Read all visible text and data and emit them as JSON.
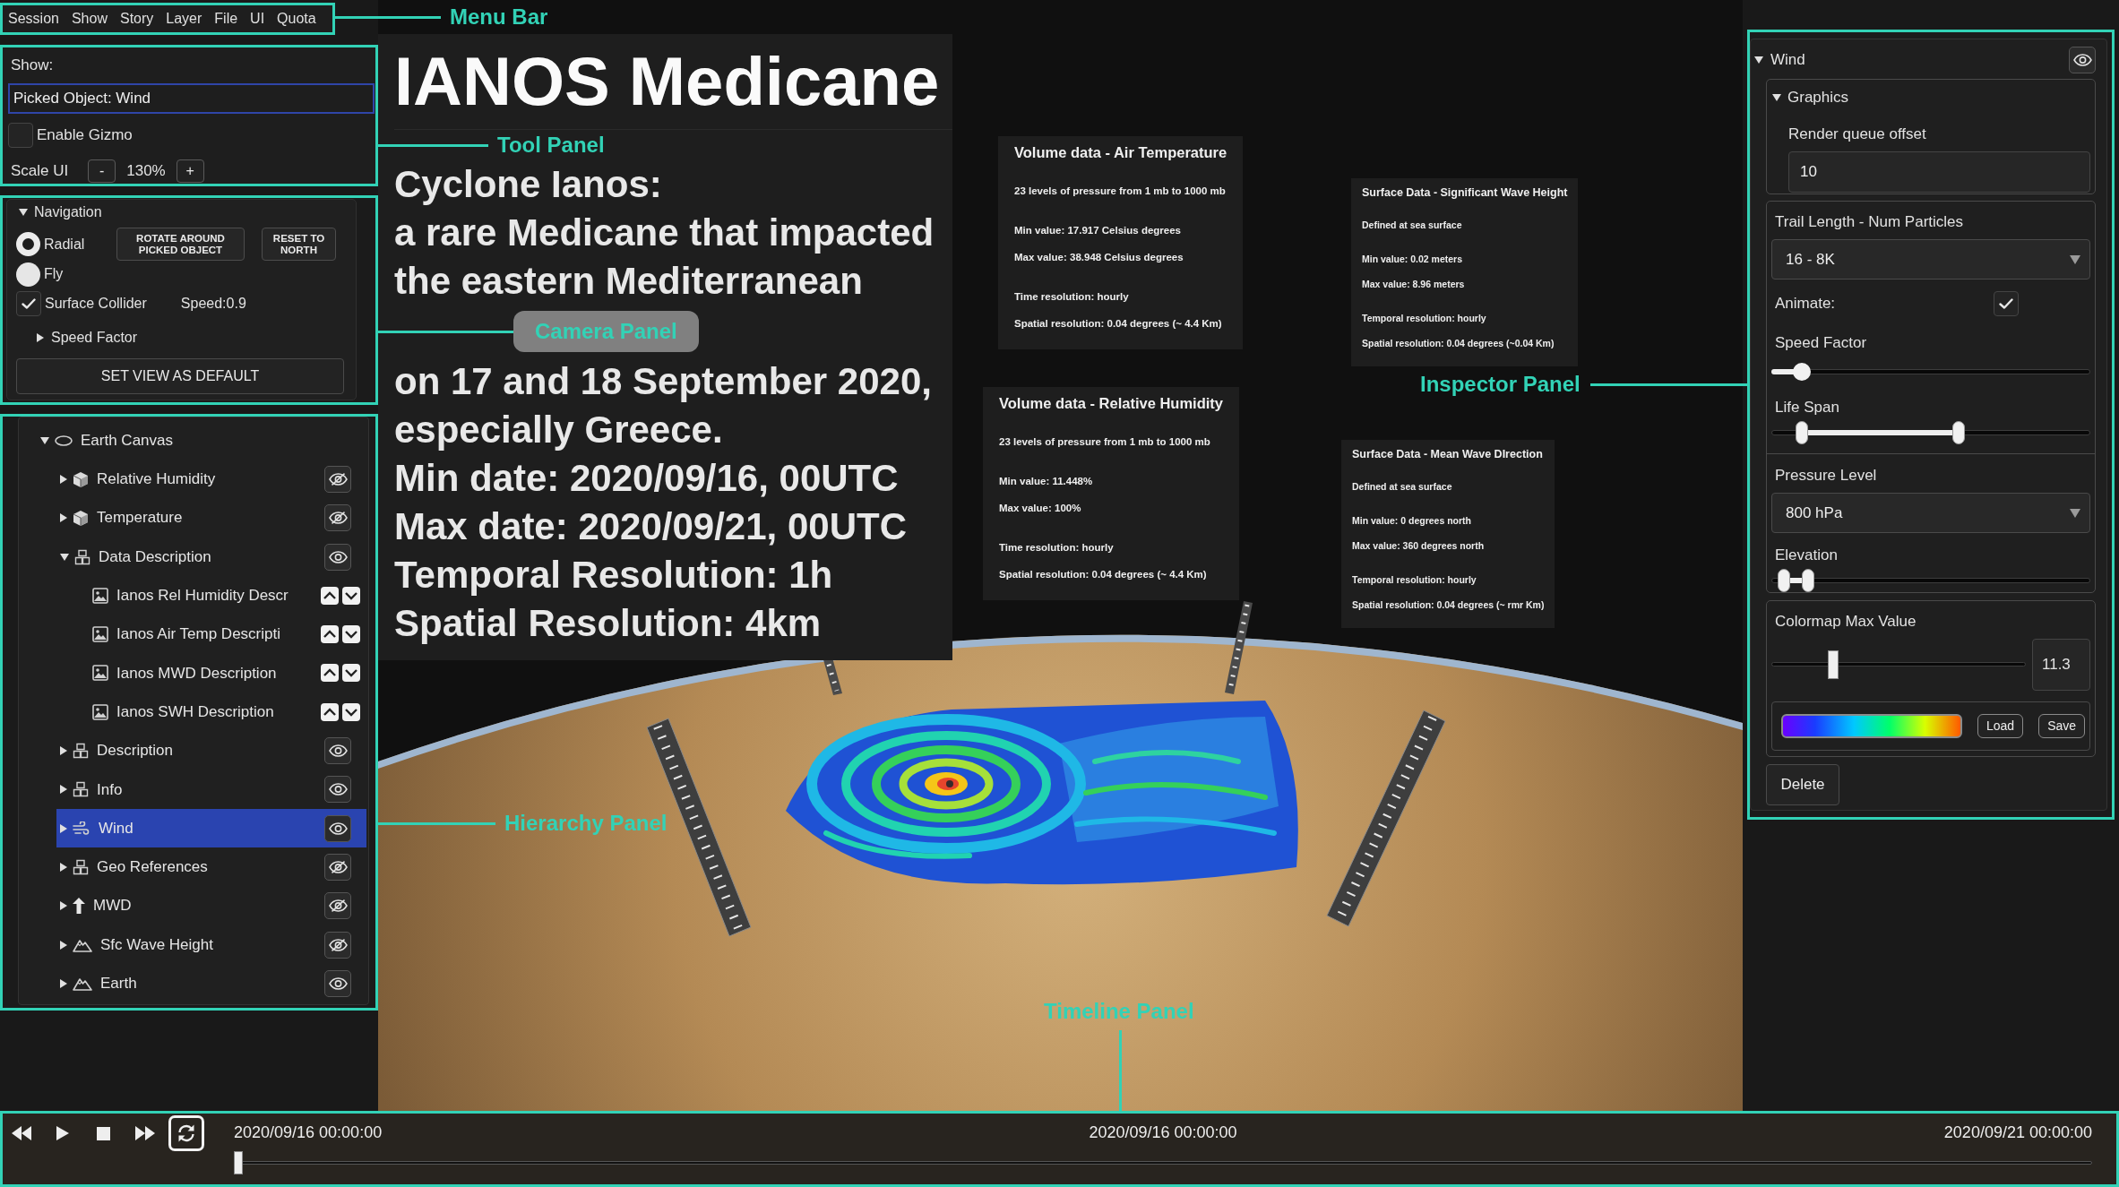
{
  "menu_bar": {
    "callout": "Menu Bar",
    "items": [
      "Session",
      "Show",
      "Story",
      "Layer",
      "File",
      "UI",
      "Quota"
    ]
  },
  "tool_panel": {
    "callout": "Tool Panel",
    "show_label": "Show:",
    "picked_object": {
      "value": "Picked Object: Wind"
    },
    "enable_gizmo": {
      "label": "Enable Gizmo",
      "checked": false
    },
    "scale_ui": {
      "label": "Scale UI",
      "decrease": "-",
      "value": "130%",
      "increase": "+"
    }
  },
  "navigation": {
    "callout": "Camera Panel",
    "title": "Navigation",
    "expanded": true,
    "modes": [
      {
        "label": "Radial",
        "selected": true
      },
      {
        "label": "Fly",
        "selected": false
      }
    ],
    "buttons": [
      "ROTATE AROUND PICKED OBJECT",
      "RESET TO NORTH"
    ],
    "surface_collider": {
      "label": "Surface Collider",
      "checked": true
    },
    "speed": "Speed:0.9",
    "speed_factor": {
      "label": "Speed Factor",
      "expanded": false
    },
    "default_button": "SET VIEW AS DEFAULT"
  },
  "hierarchy": {
    "callout": "Hierarchy Panel",
    "items": [
      {
        "label": "Earth Canvas",
        "kind": "canvas",
        "expanded": true,
        "selected": false,
        "children": [
          {
            "label": "Relative Humidity",
            "kind": "volume",
            "expanded": false,
            "visible": false,
            "selected": false
          },
          {
            "label": "Temperature",
            "kind": "volume",
            "expanded": false,
            "visible": false,
            "selected": false
          },
          {
            "label": "Data Description",
            "kind": "group",
            "expanded": true,
            "visible": true,
            "selected": false,
            "children": [
              {
                "label": "Ianos Rel Humidity Descr",
                "kind": "image",
                "selected": false
              },
              {
                "label": "Ianos Air Temp Descripti",
                "kind": "image",
                "selected": false
              },
              {
                "label": "Ianos MWD Description",
                "kind": "image",
                "selected": false
              },
              {
                "label": "Ianos SWH Description",
                "kind": "image",
                "selected": false
              }
            ]
          },
          {
            "label": "Description",
            "kind": "group",
            "expanded": false,
            "visible": true,
            "selected": false
          },
          {
            "label": "Info",
            "kind": "group",
            "expanded": false,
            "visible": true,
            "selected": false
          },
          {
            "label": "Wind",
            "kind": "wind",
            "expanded": false,
            "visible": true,
            "selected": true
          },
          {
            "label": "Geo References",
            "kind": "group",
            "expanded": false,
            "visible": false,
            "selected": false
          },
          {
            "label": "MWD",
            "kind": "vector",
            "expanded": false,
            "visible": false,
            "selected": false
          },
          {
            "label": "Sfc Wave Height",
            "kind": "terrain",
            "expanded": false,
            "visible": false,
            "selected": false
          },
          {
            "label": "Earth",
            "kind": "terrain",
            "expanded": false,
            "visible": true,
            "selected": false
          }
        ]
      }
    ]
  },
  "scene": {
    "title": "IANOS Medicane",
    "lines": [
      "Cyclone Ianos:",
      "a rare Medicane that impacted",
      "the eastern Mediterranean",
      "on 17 and 18 September 2020,",
      "especially Greece.",
      "Min date: 2020/09/16, 00UTC",
      "Max date: 2020/09/21, 00UTC",
      "Temporal Resolution: 1h",
      "Spatial Resolution: 4km"
    ],
    "cards": [
      {
        "kind": "volume",
        "title": "Volume data - Air Temperature",
        "groups": [
          [
            "23 levels of pressure from 1 mb to 1000 mb"
          ],
          [
            "Min value: 17.917 Celsius degrees",
            "Max value: 38.948 Celsius degrees"
          ],
          [
            "Time resolution: hourly",
            "Spatial resolution: 0.04 degrees (~ 4.4 Km)"
          ]
        ]
      },
      {
        "kind": "surface",
        "title": "Surface Data - Significant Wave Height",
        "groups": [
          [
            "Defined at sea surface"
          ],
          [
            "Min value: 0.02 meters",
            "Max value: 8.96 meters"
          ],
          [
            "Temporal resolution: hourly",
            "Spatial resolution: 0.04 degrees (~0.04 Km)"
          ]
        ]
      },
      {
        "kind": "volume",
        "title": "Volume data - Relative Humidity",
        "groups": [
          [
            "23 levels of pressure from 1 mb to 1000 mb"
          ],
          [
            "Min value: 11.448%",
            "Max value: 100%"
          ],
          [
            "Time resolution: hourly",
            "Spatial resolution: 0.04 degrees (~ 4.4 Km)"
          ]
        ]
      },
      {
        "kind": "surface",
        "title": "Surface Data - Mean Wave DIrection",
        "groups": [
          [
            "Defined at sea surface"
          ],
          [
            "Min value: 0 degrees north",
            "Max value: 360 degrees north"
          ],
          [
            "Temporal resolution: hourly",
            "Spatial resolution: 0.04 degrees (~ rmr Km)"
          ]
        ]
      }
    ]
  },
  "inspector": {
    "callout": "Inspector Panel",
    "title": "Wind",
    "expanded": true,
    "visible": true,
    "graphics": {
      "title": "Graphics",
      "expanded": true,
      "label": "Render queue offset",
      "value": "10"
    },
    "trail_length": {
      "label": "Trail Length - Num Particles",
      "value": "16 - 8K"
    },
    "animate": {
      "label": "Animate:",
      "checked": true
    },
    "speed_factor": {
      "label": "Speed Factor",
      "level": 0.07
    },
    "life_span": {
      "label": "Life Span",
      "thumbs": [
        {
          "level": 0.08
        },
        {
          "level": 0.59
        }
      ]
    },
    "pressure_level": {
      "label": "Pressure Level",
      "value": "800 hPa"
    },
    "elevation": {
      "label": "Elevation",
      "thumbs": [
        {
          "level": 0.02
        },
        {
          "level": 0.1
        }
      ]
    },
    "colormap": {
      "label": "Colormap Max Value",
      "level": 0.23,
      "value": "11.3",
      "load": "Load",
      "save": "Save"
    },
    "delete": "Delete"
  },
  "timeline": {
    "callout": "Timeline Panel",
    "loop": {
      "on": true
    },
    "start": "2020/09/16 00:00:00",
    "current": "2020/09/16 00:00:00",
    "end": "2020/09/21 00:00:00",
    "level": 0
  }
}
